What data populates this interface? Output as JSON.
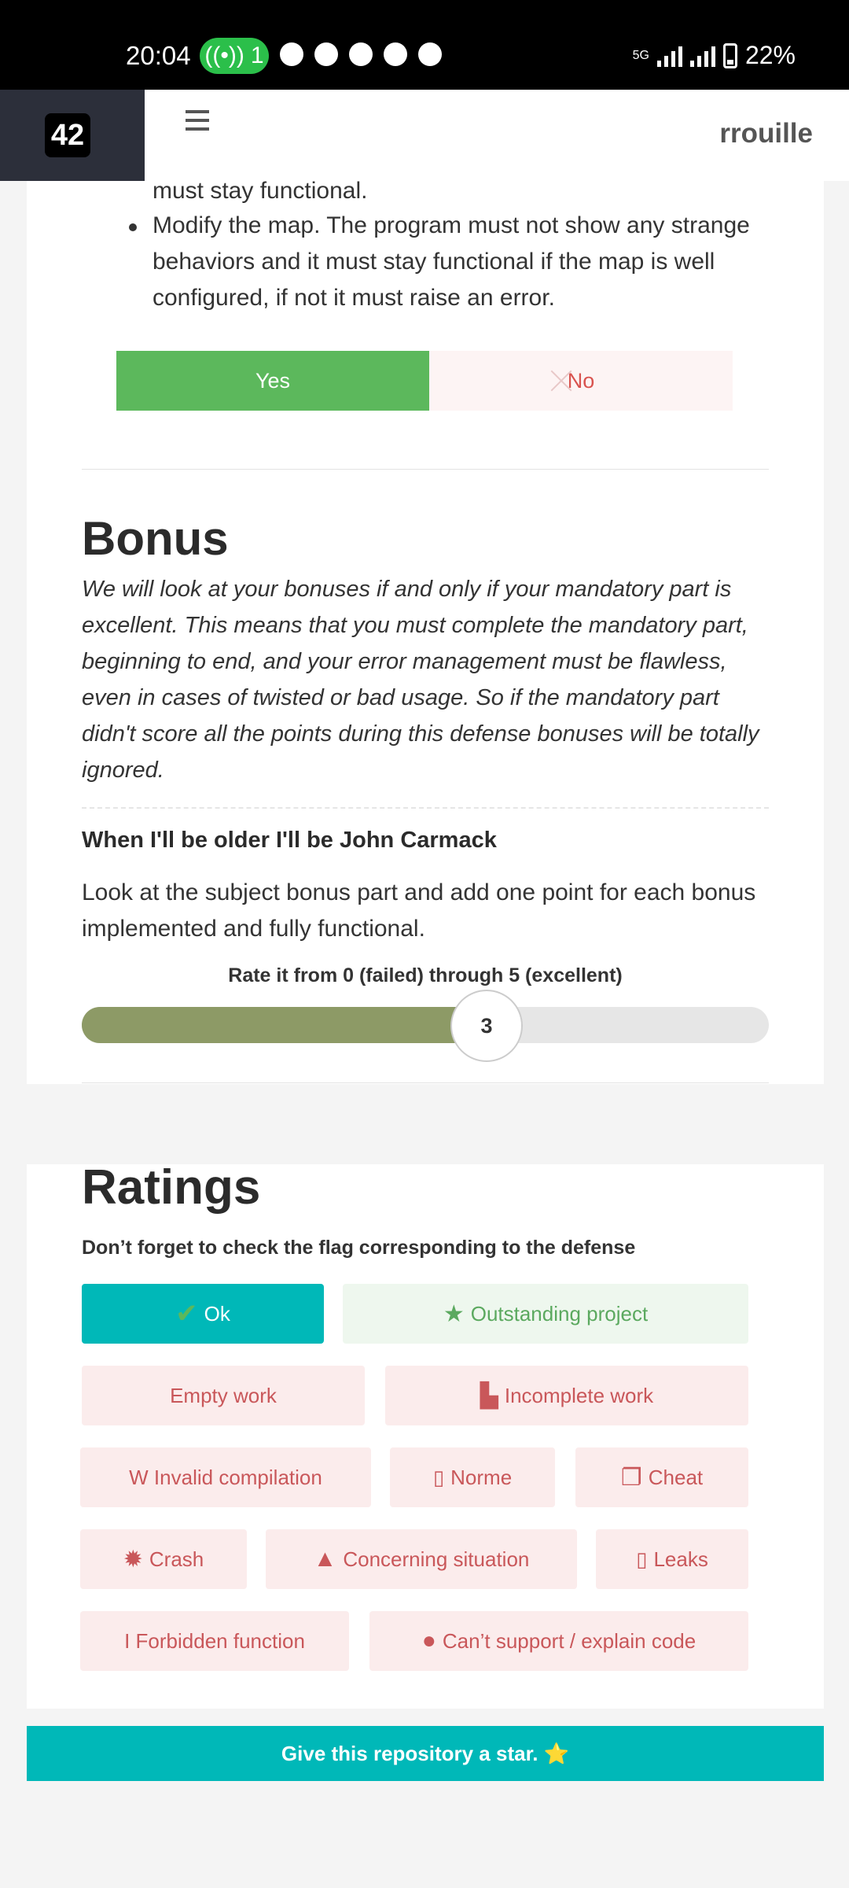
{
  "status_bar": {
    "time": "20:04",
    "hotspot_count": "1",
    "network": "5G",
    "battery": "22%"
  },
  "app_header": {
    "logo_text": "42",
    "username": "rrouille"
  },
  "scale_section": {
    "cut_text": "must stay functional.",
    "bullet": "Modify the map. The program must not show any strange behaviors and it must stay functional if the map is well configured, if not it must raise an error.",
    "yes_label": "Yes",
    "no_label": "No"
  },
  "bonus": {
    "title": "Bonus",
    "description": "We will look at your bonuses if and only if your mandatory part is excellent. This means that you must complete the mandatory part, beginning to end, and your error management must be flawless, even in cases of twisted or bad usage. So if the mandatory part didn't score all the points during this defense bonuses will be totally ignored.",
    "question_title": "When I'll be older I'll be John Carmack",
    "question_desc": "Look at the subject bonus part and add one point for each bonus implemented and fully functional.",
    "rate_label": "Rate it from 0 (failed) through 5 (excellent)",
    "rating_value": 3,
    "rating_max": 5,
    "rating_display": "3"
  },
  "ratings": {
    "title": "Ratings",
    "subtitle": "Don’t forget to check the flag corresponding to the defense",
    "flags": {
      "ok": "Ok",
      "outstanding": "Outstanding project",
      "empty": "Empty work",
      "incomplete": "Incomplete work",
      "invalid": "W Invalid compilation",
      "norme": "Norme",
      "cheat": "Cheat",
      "crash": "Crash",
      "concerning": "Concerning situation",
      "leaks": "Leaks",
      "forbidden": "I Forbidden function",
      "cant_support": "Can’t support / explain code"
    }
  },
  "footer": {
    "star_text": "Give this repository a star. ⭐"
  },
  "colors": {
    "teal": "#00b8b8",
    "green": "#5cb85c",
    "slider_fill": "#8d9a66",
    "danger_text": "#c9575a"
  }
}
